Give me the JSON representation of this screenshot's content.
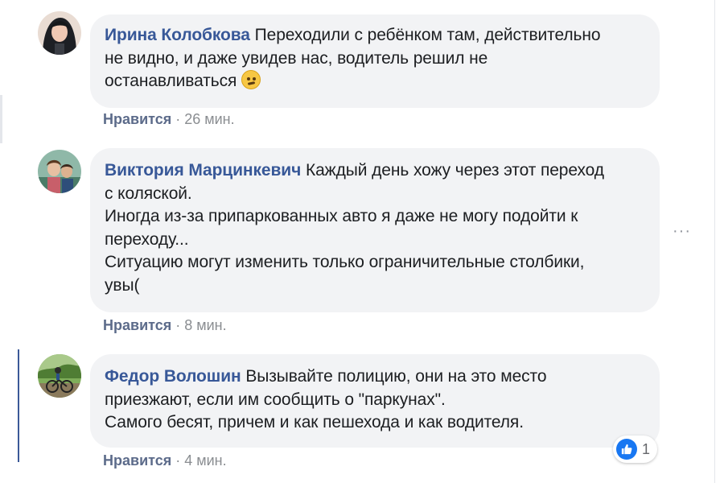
{
  "comments": [
    {
      "author": "Ирина Колобкова",
      "lines": [
        "Переходили с ребёнком там, действительно",
        "не видно, и даже увидев нас, водитель решил не",
        "останавливаться"
      ],
      "like_label": "Нравится",
      "separator": "·",
      "time": "26 мин."
    },
    {
      "author": "Виктория Марцинкевич",
      "lines": [
        "Каждый день хожу через этот переход",
        "с коляской.",
        "Иногда из-за припаркованных авто я даже не могу подойти к",
        "переходу...",
        "Ситуацию могут изменить только ограничительные столбики,",
        "увы("
      ],
      "like_label": "Нравится",
      "separator": "·",
      "time": "8 мин."
    },
    {
      "author": "Федор Волошин",
      "lines": [
        "Вызывайте полицию, они на это место",
        "приезжают, если им сообщить о \"паркунах\".",
        "Самого бесят, причем и как пешехода и как водителя."
      ],
      "like_label": "Нравится",
      "separator": "·",
      "time": "4 мин.",
      "reaction_count": "1"
    }
  ],
  "icons": {
    "emoji": "confused-face-icon",
    "more": "more-options-icon",
    "reaction": "like-reaction-icon"
  },
  "colors": {
    "author": "#385898",
    "bubble": "#f2f3f5",
    "like_blue": "#1877f2",
    "meta": "#8a8d91"
  }
}
